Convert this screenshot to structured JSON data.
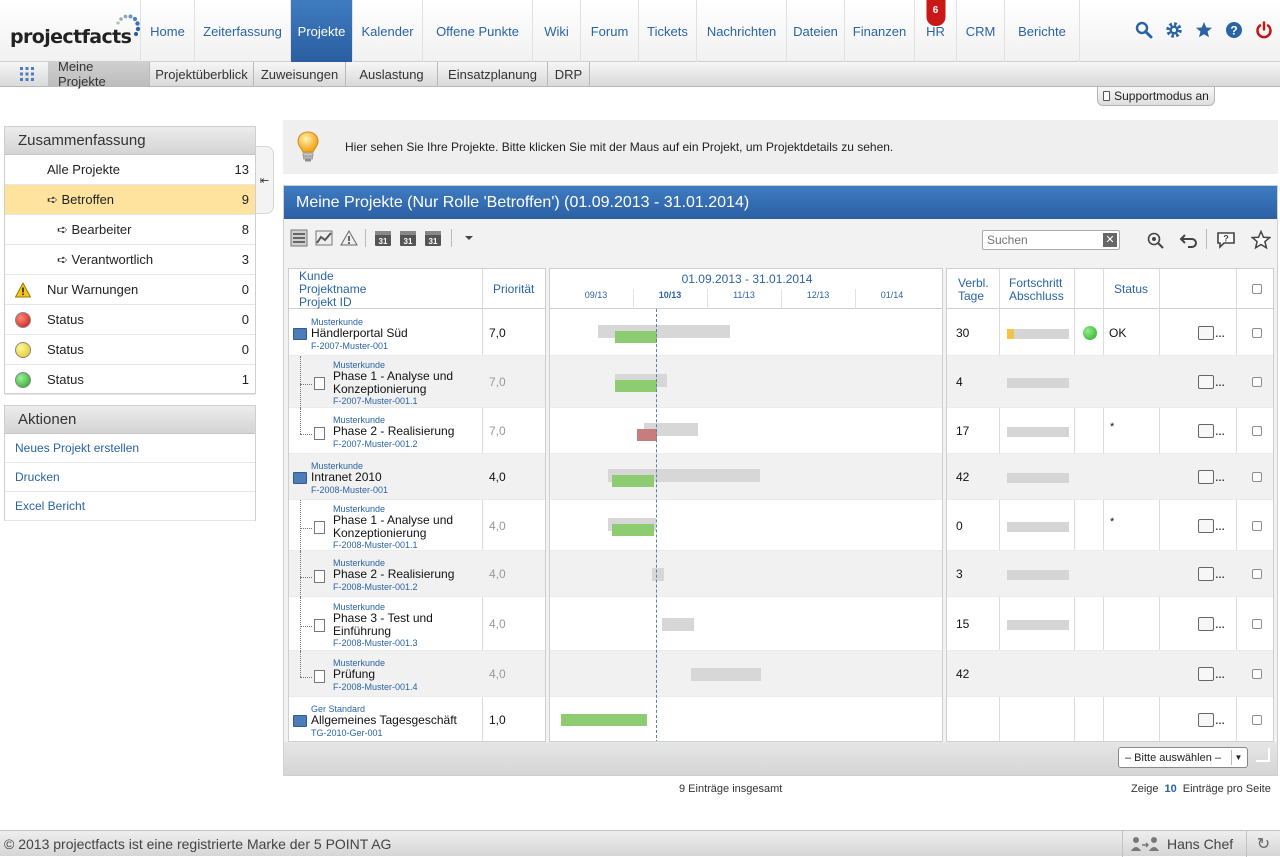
{
  "app": {
    "logo_text": "projectfacts"
  },
  "nav": {
    "items": [
      {
        "label": "Home"
      },
      {
        "label": "Zeiterfassung"
      },
      {
        "label": "Projekte"
      },
      {
        "label": "Kalender"
      },
      {
        "label": "Offene Punkte"
      },
      {
        "label": "Wiki"
      },
      {
        "label": "Forum"
      },
      {
        "label": "Tickets"
      },
      {
        "label": "Nachrichten"
      },
      {
        "label": "Dateien"
      },
      {
        "label": "Finanzen"
      },
      {
        "label": "HR",
        "badge": "6"
      },
      {
        "label": "CRM"
      },
      {
        "label": "Berichte"
      }
    ],
    "active_index": 2,
    "icons": [
      "search-icon",
      "gear-icon",
      "star-icon",
      "help-icon",
      "power-icon"
    ]
  },
  "subnav": {
    "tabs": [
      {
        "label": "Meine Projekte"
      },
      {
        "label": "Projektüberblick"
      },
      {
        "label": "Zuweisungen"
      },
      {
        "label": "Auslastung"
      },
      {
        "label": "Einsatzplanung"
      },
      {
        "label": "DRP"
      }
    ],
    "active_index": 0
  },
  "support_button": "Supportmodus an",
  "summary": {
    "title": "Zusammenfassung",
    "rows": [
      {
        "label": "Alle Projekte",
        "count": "13"
      },
      {
        "label": "➪ Betroffen",
        "count": "9"
      },
      {
        "label": "➪ Bearbeiter",
        "count": "8"
      },
      {
        "label": "➪ Verantwortlich",
        "count": "3"
      },
      {
        "label": "Nur Warnungen",
        "count": "0"
      },
      {
        "label": "Status",
        "count": "0"
      },
      {
        "label": "Status",
        "count": "0"
      },
      {
        "label": "Status",
        "count": "1"
      }
    ]
  },
  "actions": {
    "title": "Aktionen",
    "items": [
      {
        "label": "Neues Projekt erstellen"
      },
      {
        "label": "Drucken"
      },
      {
        "label": "Excel Bericht"
      }
    ]
  },
  "info": {
    "text": "Hier sehen Sie Ihre Projekte. Bitte klicken Sie mit der Maus auf ein Projekt, um Projektdetails zu sehen."
  },
  "projects_panel": {
    "title": "Meine Projekte (Nur Rolle 'Betroffen') (01.09.2013 - 31.01.2014)",
    "search_placeholder": "Suchen",
    "headers": {
      "kunde": "Kunde",
      "projektname": "Projektname",
      "projekt_id": "Projekt ID",
      "prioritaet": "Priorität",
      "gantt_range": "01.09.2013 - 31.01.2014",
      "months": [
        "09/13",
        "10/13",
        "11/13",
        "12/13",
        "01/14"
      ],
      "current_month_index": 1,
      "verbl_tage_1": "Verbl.",
      "verbl_tage_2": "Tage",
      "fortschritt_1": "Fortschritt",
      "fortschritt_2": "Abschluss",
      "status": "Status"
    },
    "rows": [
      {
        "customer": "Musterkunde",
        "name1": "Händlerportal Süd",
        "name2": "",
        "id": "F-2007-Muster-001",
        "priority": "7,0",
        "days": "30",
        "progress": 0.12,
        "status": "OK",
        "status_dot": true,
        "note": "",
        "level": 0
      },
      {
        "customer": "Musterkunde",
        "name1": "Phase 1 - Analyse und",
        "name2": "Konzeptionierung",
        "id": "F-2007-Muster-001.1",
        "priority": "7,0",
        "days": "4",
        "progress": 0,
        "status": "",
        "note": "",
        "level": 1
      },
      {
        "customer": "Musterkunde",
        "name1": "Phase 2 - Realisierung",
        "name2": "",
        "id": "F-2007-Muster-001.2",
        "priority": "7,0",
        "days": "17",
        "progress": 0,
        "status": "",
        "note": "*",
        "level": 1
      },
      {
        "customer": "Musterkunde",
        "name1": "Intranet 2010",
        "name2": "",
        "id": "F-2008-Muster-001",
        "priority": "4,0",
        "days": "42",
        "progress": 0,
        "status": "",
        "note": "",
        "level": 0
      },
      {
        "customer": "Musterkunde",
        "name1": "Phase 1 - Analyse und",
        "name2": "Konzeptionierung",
        "id": "F-2008-Muster-001.1",
        "priority": "4,0",
        "days": "0",
        "progress": 0,
        "status": "",
        "note": "*",
        "level": 1
      },
      {
        "customer": "Musterkunde",
        "name1": "Phase 2 - Realisierung",
        "name2": "",
        "id": "F-2008-Muster-001.2",
        "priority": "4,0",
        "days": "3",
        "progress": 0,
        "status": "",
        "note": "",
        "level": 1
      },
      {
        "customer": "Musterkunde",
        "name1": "Phase 3 - Test und",
        "name2": "Einführung",
        "id": "F-2008-Muster-001.3",
        "priority": "4,0",
        "days": "15",
        "progress": 0,
        "status": "",
        "note": "",
        "level": 1
      },
      {
        "customer": "Musterkunde",
        "name1": "Prüfung",
        "name2": "",
        "id": "F-2008-Muster-001.4",
        "priority": "4,0",
        "days": "42",
        "progress": null,
        "status": "",
        "note": "",
        "level": 1
      },
      {
        "customer": "Ger Standard",
        "name1": "Allgemeines Tagesgeschäft",
        "name2": "",
        "id": "TG-2010-Ger-001",
        "priority": "1,0",
        "days": "",
        "progress": null,
        "status": "",
        "note": "",
        "level": 0
      }
    ],
    "select_label": "– Bitte auswählen –",
    "total_entries": "9 Einträge insgesamt",
    "per_page_prefix": "Zeige",
    "per_page_value": "10",
    "per_page_suffix": "Einträge pro Seite"
  },
  "footer": {
    "copyright": "© 2013 projectfacts ist eine registrierte Marke der 5 POINT AG",
    "user": "Hans Chef"
  },
  "colors": {
    "nav_active": "#2f6aae",
    "link": "#2a64a5",
    "selected_row": "#fde39d",
    "progress_done": "#8dcc71",
    "progress_late": "#c57e7c"
  }
}
